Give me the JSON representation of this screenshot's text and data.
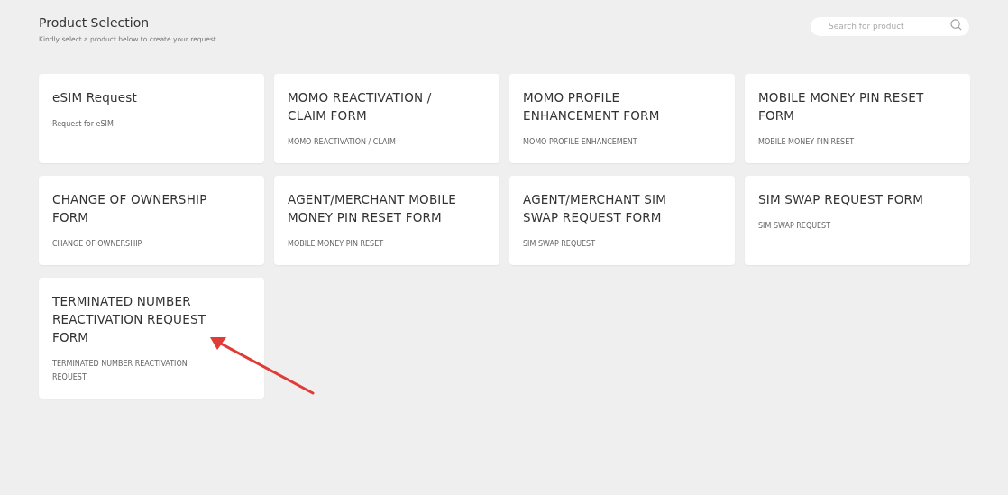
{
  "header": {
    "title": "Product Selection",
    "subtitle": "Kindly select a product below to create your request."
  },
  "search": {
    "placeholder": "Search for product"
  },
  "products": [
    {
      "title": "eSIM Request",
      "description": "Request for eSIM"
    },
    {
      "title": "MOMO REACTIVATION / CLAIM FORM",
      "description": "MOMO REACTIVATION / CLAIM"
    },
    {
      "title": "MOMO PROFILE ENHANCEMENT FORM",
      "description": "MOMO PROFILE ENHANCEMENT"
    },
    {
      "title": "MOBILE MONEY PIN RESET FORM",
      "description": "MOBILE MONEY PIN RESET"
    },
    {
      "title": "CHANGE OF OWNERSHIP FORM",
      "description": "CHANGE OF OWNERSHIP"
    },
    {
      "title": "AGENT/MERCHANT MOBILE MONEY PIN RESET FORM",
      "description": "MOBILE MONEY PIN RESET"
    },
    {
      "title": "AGENT/MERCHANT SIM SWAP REQUEST FORM",
      "description": "SIM SWAP REQUEST"
    },
    {
      "title": "SIM SWAP REQUEST FORM",
      "description": "SIM SWAP REQUEST"
    },
    {
      "title": "TERMINATED NUMBER REACTIVATION REQUEST FORM",
      "description": "TERMINATED NUMBER REACTIVATION REQUEST"
    }
  ]
}
